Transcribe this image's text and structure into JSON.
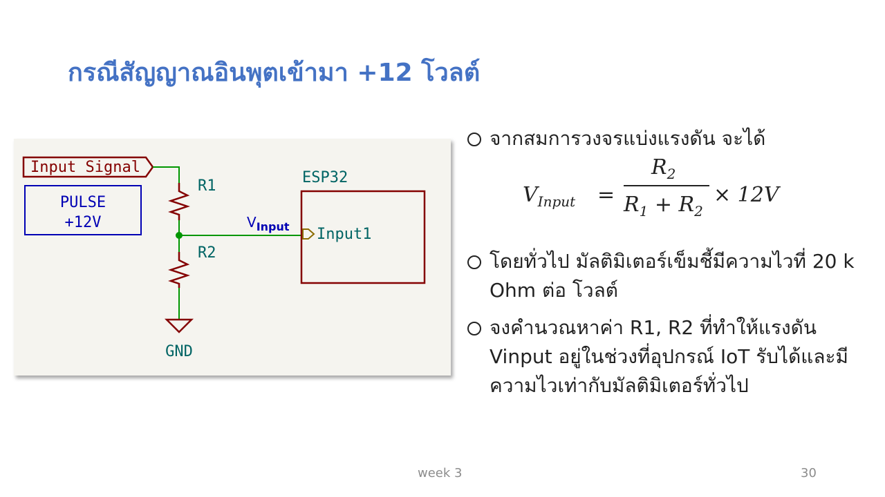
{
  "slide": {
    "title": "กรณีสัญญาณอินพุตเข้ามา +12 โวลต์",
    "footer_week": "week 3",
    "page_number": "30"
  },
  "schematic": {
    "input_label": "Input Signal",
    "source_line1": "PULSE",
    "source_line2": "+12V",
    "r1_label": "R1",
    "r2_label": "R2",
    "gnd_label": "GND",
    "esp_label": "ESP32",
    "pin_label": "Input1",
    "net_label_main": "V",
    "net_label_sub": "Input",
    "colors": {
      "resistor": "#840000",
      "wire": "#009600",
      "text": "#006464",
      "source_box": "#0000b4",
      "label_box": "#840000",
      "pin_marker": "#8b6b00",
      "background": "#f5f4ef"
    }
  },
  "bullets": [
    {
      "text": "จากสมการวงจรแบ่งแรงดัน จะได้"
    },
    {
      "text": "โดยทั่วไป มัลติมิเตอร์เข็มชี้มีความไวที่ 20 k Ohm ต่อ โวลต์"
    },
    {
      "text": "จงคำนวณหาค่า R1, R2 ที่ทำให้แรงดัน Vinput อยู่ในช่วงที่อุปกรณ์ IoT รับได้และมีความไวเท่ากับมัลติมิเตอร์ทั่วไป"
    }
  ],
  "formula": {
    "lhs_var": "V",
    "lhs_sub": "Input",
    "equals": "=",
    "num_var": "R",
    "num_sub": "2",
    "den_var1": "R",
    "den_sub1": "1",
    "den_plus": " + ",
    "den_var2": "R",
    "den_sub2": "2",
    "times": "× 12V"
  }
}
